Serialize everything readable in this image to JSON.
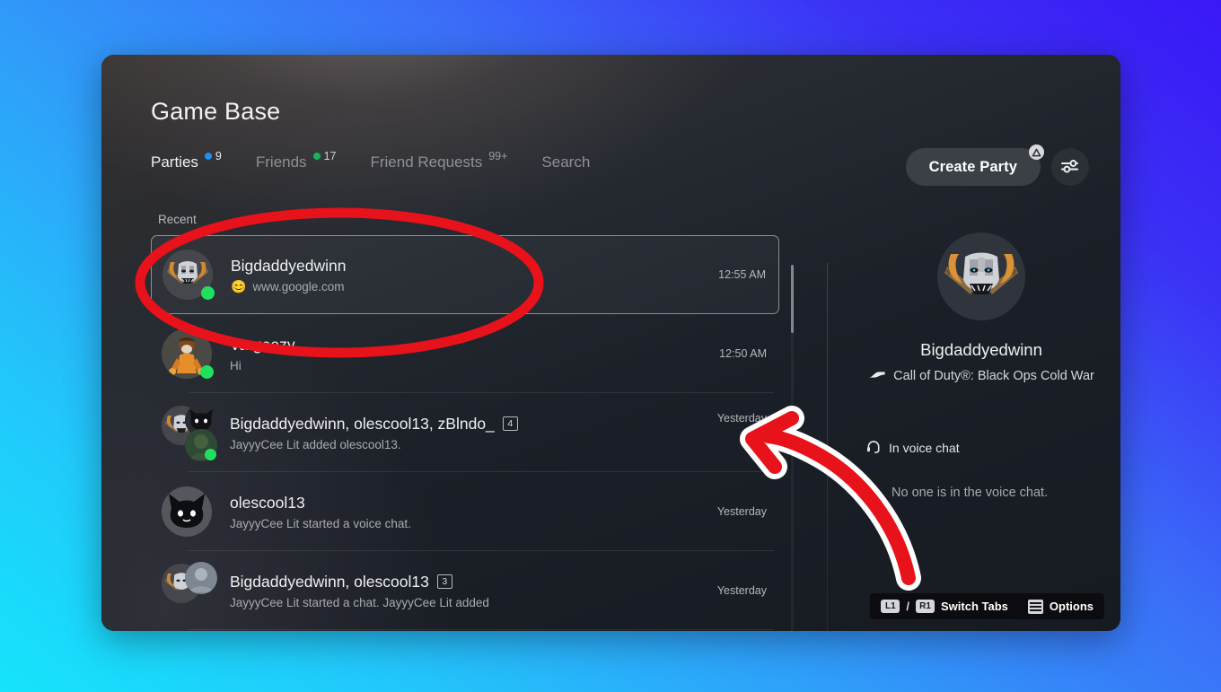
{
  "window": {
    "title": "Game Base"
  },
  "tabs": [
    {
      "label": "Parties",
      "count": "9",
      "dot": "blue",
      "active": true
    },
    {
      "label": "Friends",
      "count": "17",
      "dot": "green",
      "active": false
    },
    {
      "label": "Friend Requests",
      "count": "99+",
      "dot": "none",
      "active": false
    },
    {
      "label": "Search",
      "count": "",
      "dot": "none",
      "active": false
    }
  ],
  "header_actions": {
    "create_party_label": "Create Party",
    "create_party_badge": "triangle-button-icon",
    "filter_icon": "sliders-icon"
  },
  "list": {
    "heading": "Recent",
    "rows": [
      {
        "title": "Bigdaddyedwinn",
        "subtitle": "www.google.com",
        "emoji": "😊",
        "time": "12:55 AM",
        "member_count": "",
        "selected": true,
        "online": true,
        "avatar_type": "oni",
        "has_voice_icon": false
      },
      {
        "title": "Vargeezy",
        "subtitle": "Hi",
        "emoji": "",
        "time": "12:50 AM",
        "member_count": "",
        "selected": false,
        "online": true,
        "avatar_type": "orange-character",
        "has_voice_icon": false
      },
      {
        "title": "Bigdaddyedwinn, olescool13, zBlndo_",
        "subtitle": "JayyyCee Lit added olescool13.",
        "emoji": "",
        "time": "Yesterday",
        "member_count": "4",
        "selected": false,
        "online": true,
        "avatar_type": "group-3",
        "has_voice_icon": true
      },
      {
        "title": "olescool13",
        "subtitle": "JayyyCee Lit started a voice chat.",
        "emoji": "",
        "time": "Yesterday",
        "member_count": "",
        "selected": false,
        "online": false,
        "avatar_type": "black-cat",
        "has_voice_icon": false
      },
      {
        "title": "Bigdaddyedwinn, olescool13",
        "subtitle": "JayyyCee Lit started a chat. JayyyCee Lit added",
        "emoji": "",
        "time": "Yesterday",
        "member_count": "3",
        "selected": false,
        "online": false,
        "avatar_type": "group-2",
        "has_voice_icon": false
      }
    ]
  },
  "detail": {
    "name": "Bigdaddyedwinn",
    "activity": "Call of Duty®: Black Ops Cold War",
    "activity_icon": "ps5-game-icon",
    "voice_heading": "In voice chat",
    "voice_heading_icon": "headset-icon",
    "voice_empty": "No one is in the voice chat."
  },
  "footer": {
    "switch_tabs_label": "Switch Tabs",
    "switch_tabs_keys": [
      "L1",
      "R1"
    ],
    "switch_tabs_separator": "/",
    "options_label": "Options",
    "options_icon": "hamburger-icon"
  },
  "annotations": {
    "ellipse": "red-highlight-ellipse",
    "arrow": "red-pointing-arrow"
  },
  "colors": {
    "background_start": "#15e4fb",
    "background_end": "#3a18f6",
    "window_bg": "#191d24",
    "accent_blue": "#1e8ef0",
    "accent_green": "#19b35a",
    "status_green": "#1fe05f",
    "annotation_red": "#e8121b",
    "text_primary": "#f0f0f1",
    "text_secondary": "#a9abaf"
  }
}
